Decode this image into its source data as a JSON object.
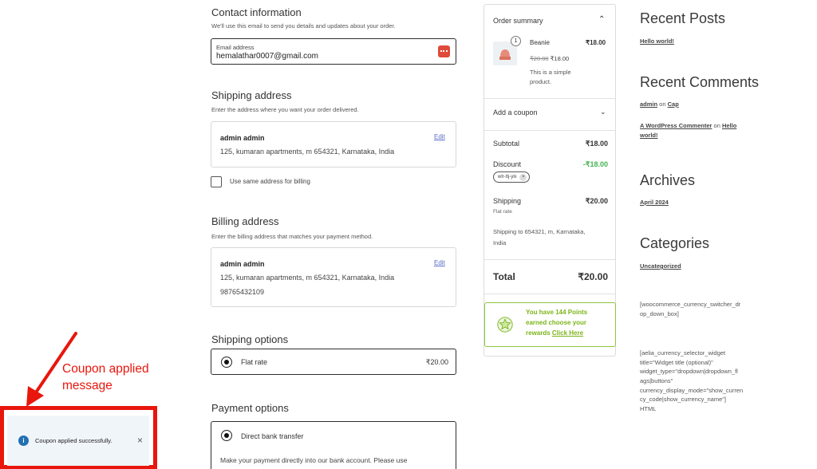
{
  "contact": {
    "title": "Contact information",
    "subtitle": "We'll use this email to send you details and updates about your order.",
    "email_label": "Email address",
    "email_value": "hemalathar0007@gmail.com"
  },
  "shipping": {
    "title": "Shipping address",
    "subtitle": "Enter the address where you want your order delivered.",
    "name": "admin admin",
    "address": "125, kumaran apartments, m 654321, Karnataka, India",
    "edit_label": "Edit",
    "same_billing_label": "Use same address for billing"
  },
  "billing": {
    "title": "Billing address",
    "subtitle": "Enter the billing address that matches your payment method.",
    "name": "admin admin",
    "address": "125, kumaran apartments, m 654321, Karnataka, India",
    "phone": "98765432109",
    "edit_label": "Edit"
  },
  "shipping_options": {
    "title": "Shipping options",
    "option_label": "Flat rate",
    "option_price": "₹20.00"
  },
  "payment": {
    "title": "Payment options",
    "option_label": "Direct bank transfer",
    "description": "Make your payment directly into our bank account. Please use"
  },
  "summary": {
    "title": "Order summary",
    "item": {
      "qty": "1",
      "name": "Beanie",
      "price": "₹18.00",
      "old_price": "₹20.00",
      "new_price": "₹18.00",
      "desc_line1": "This is a simple",
      "desc_line2": "product."
    },
    "coupon_label": "Add a coupon",
    "subtotal_label": "Subtotal",
    "subtotal_value": "₹18.00",
    "discount_label": "Discount",
    "discount_value": "-₹18.00",
    "coupon_code": "wlr-ttj-ylx",
    "shipping_label": "Shipping",
    "shipping_value": "₹20.00",
    "shipping_method": "Flat rate",
    "shipping_to_line1": "Shipping to 654321, m, Karnataka,",
    "shipping_to_line2": "India",
    "total_label": "Total",
    "total_value": "₹20.00"
  },
  "points": {
    "line1": "You have 144 Points",
    "line2": "earned choose your",
    "line3_prefix": "rewards ",
    "link": "Click Here"
  },
  "sidebar": {
    "recent_posts_title": "Recent Posts",
    "post_link": "Hello world!",
    "recent_comments_title": "Recent Comments",
    "comment1_author": "admin",
    "comment1_on": " on ",
    "comment1_post": "Cap",
    "comment2_author": "A WordPress Commenter",
    "comment2_on": " on ",
    "comment2_post_a": "Hello",
    "comment2_post_b": "world!",
    "archives_title": "Archives",
    "archive_link": "April 2024",
    "categories_title": "Categories",
    "category_link": "Uncategorized",
    "shortcode1_a": "[woocommerce_currency_switcher_dr",
    "shortcode1_b": "op_down_box]",
    "shortcode2_lines": [
      "[aelia_currency_selector_widget",
      "title=\"Widget title (optional)\"",
      "widget_type=\"dropdown|dropdown_fl",
      "ags|buttons\"",
      "currency_display_mode=\"show_curren",
      "cy_code|show_currency_name\"]",
      "HTML"
    ]
  },
  "annotation": {
    "line1": "Coupon applied",
    "line2": "message"
  },
  "toast": {
    "message": "Coupon applied successfully.",
    "close": "×"
  },
  "colors": {
    "annotation_red": "#e8160c",
    "points_green": "#7cb518",
    "discount_green": "#46b450",
    "info_blue": "#2271b1"
  }
}
